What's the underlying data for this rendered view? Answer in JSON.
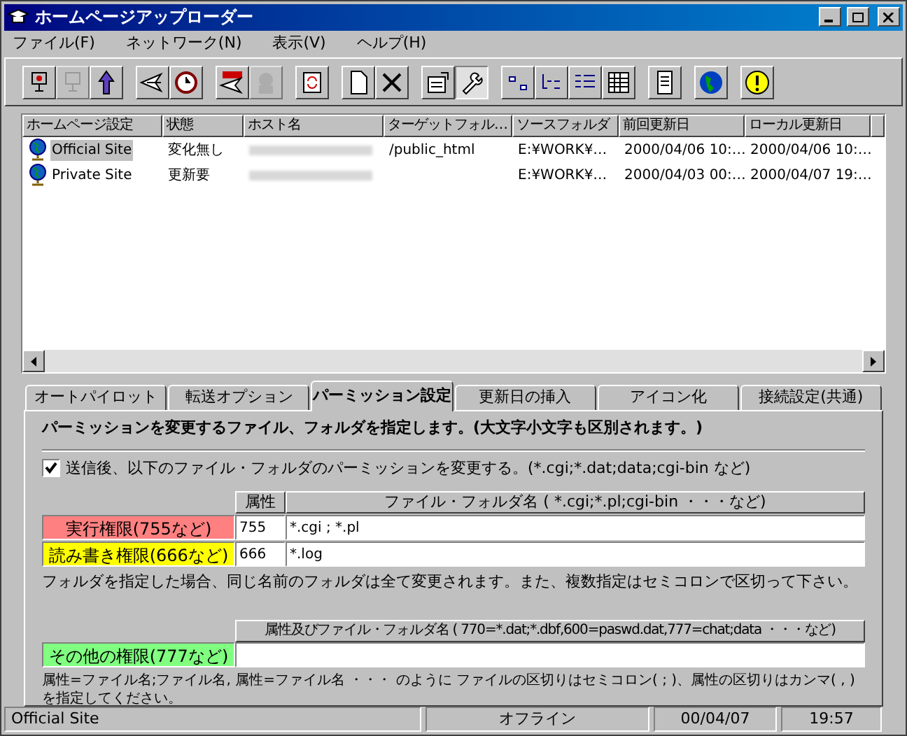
{
  "window": {
    "title": "ホームページアップローダー"
  },
  "menu": [
    "ファイル(F)",
    "ネットワーク(N)",
    "表示(V)",
    "ヘルプ(H)"
  ],
  "toolbar": [
    {
      "disabled": false,
      "pressed": false
    },
    {
      "disabled": true,
      "pressed": false
    },
    {
      "disabled": false,
      "pressed": false
    },
    {
      "disabled": false,
      "pressed": false
    },
    {
      "disabled": false,
      "pressed": false
    },
    {
      "disabled": false,
      "pressed": false
    },
    {
      "disabled": true,
      "pressed": false
    },
    {
      "disabled": false,
      "pressed": false
    },
    {
      "disabled": false,
      "pressed": false
    },
    {
      "disabled": false,
      "pressed": false
    },
    {
      "disabled": false,
      "pressed": false
    },
    {
      "disabled": false,
      "pressed": true
    },
    {
      "disabled": false,
      "pressed": false
    },
    {
      "disabled": false,
      "pressed": false
    },
    {
      "disabled": false,
      "pressed": false
    },
    {
      "disabled": false,
      "pressed": false
    },
    {
      "disabled": false,
      "pressed": false
    },
    {
      "disabled": false,
      "pressed": false
    },
    {
      "disabled": false,
      "pressed": false
    }
  ],
  "table": {
    "columns": [
      "ホームページ設定",
      "状態",
      "ホスト名",
      "ターゲットフォル…",
      "ソースフォルダ",
      "前回更新日",
      "ローカル更新日"
    ],
    "rows": [
      {
        "selected": true,
        "site": "Official Site",
        "status": "変化無し",
        "target": "/public_html",
        "source": "E:¥WORK¥…",
        "last": "2000/04/06 10:…",
        "local": "2000/04/06 10:…"
      },
      {
        "selected": false,
        "site": "Private Site",
        "status": "更新要",
        "target": "",
        "source": "E:¥WORK¥…",
        "last": "2000/04/03 00:…",
        "local": "2000/04/07 19:…"
      }
    ]
  },
  "tabs": [
    {
      "label": "オートパイロット",
      "selected": false
    },
    {
      "label": "転送オプション",
      "selected": false
    },
    {
      "label": "パーミッション設定",
      "selected": true
    },
    {
      "label": "更新日の挿入",
      "selected": false
    },
    {
      "label": "アイコン化",
      "selected": false
    },
    {
      "label": "接続設定(共通)",
      "selected": false
    }
  ],
  "panel": {
    "heading": "パーミッションを変更するファイル、フォルダを指定します。(大文字小文字も区別されます。)",
    "checkbox": {
      "label": "送信後、以下のファイル・フォルダのパーミッションを変更する。(*.cgi;*.dat;data;cgi-bin など)",
      "checked": true
    },
    "grid_header": {
      "attr": "属性",
      "names": "ファイル・フォルダ名 ( *.cgi;*.pl;cgi-bin ・・・など)"
    },
    "permissions": [
      {
        "label": "実行権限(755など)",
        "color": "#ff8080",
        "attr": "755",
        "names": "*.cgi ; *.pl"
      },
      {
        "label": "読み書き権限(666など)",
        "color": "#ffff00",
        "attr": "666",
        "names": "*.log"
      }
    ],
    "note1": "フォルダを指定した場合、同じ名前のフォルダは全て変更されます。また、複数指定はセミコロンで区切って下さい。",
    "other_header": "属性及びファイル・フォルダ名 ( 770=*.dat;*.dbf,600=paswd.dat,777=chat;data ・・・など)",
    "other": {
      "label": "その他の権限(777など)",
      "color": "#80ff80"
    },
    "note2": "属性=ファイル名;ファイル名, 属性=ファイル名  ・・・  のように ファイルの区切りはセミコロン( ; )、属性の区切りはカンマ( , )を指定してください。"
  },
  "status_bar": [
    "Official Site",
    "オフライン",
    "00/04/07",
    "19:57"
  ]
}
